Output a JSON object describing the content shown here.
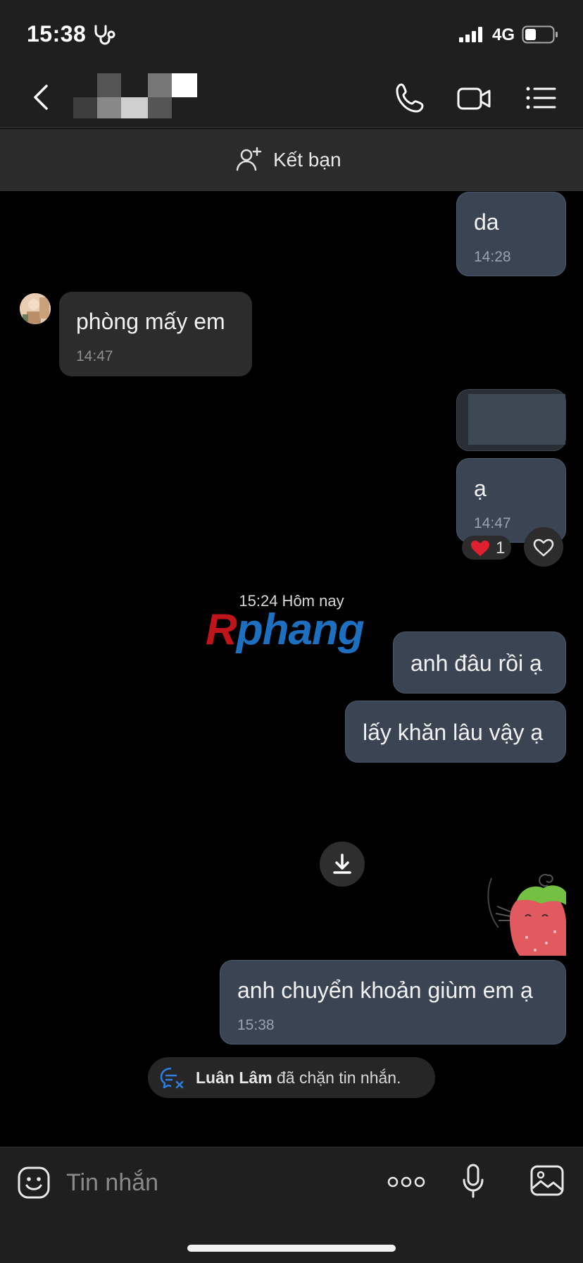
{
  "status_bar": {
    "time": "15:38",
    "network": "4G"
  },
  "header": {
    "contact_name": "",
    "icons": [
      "back-icon",
      "phone-icon",
      "video-icon",
      "menu-icon"
    ]
  },
  "add_friend": {
    "label": "Kết bạn"
  },
  "messages": [
    {
      "direction": "out",
      "text": "da",
      "time": "14:28"
    },
    {
      "direction": "in",
      "text": "phòng mấy em",
      "time": "14:47"
    },
    {
      "direction": "out",
      "text": "",
      "time": ""
    },
    {
      "direction": "out",
      "text": "ạ",
      "time": "14:47",
      "reaction": {
        "emoji": "heart",
        "count": "1"
      }
    },
    {
      "direction": "out",
      "text": "anh đâu rồi ạ",
      "time": ""
    },
    {
      "direction": "out",
      "text": "lấy khăn lâu vậy ạ",
      "time": ""
    },
    {
      "direction": "out",
      "text": "anh chuyển khoản giùm em ạ",
      "time": "15:38"
    }
  ],
  "date_separator": "15:24 Hôm nay",
  "watermark": {
    "first": "R",
    "rest": "phang"
  },
  "block_notice": {
    "name": "Luân Lâm",
    "text": " đã chặn tin nhắn."
  },
  "composer": {
    "placeholder": "Tin nhắn"
  },
  "colors": {
    "background": "#000000",
    "bar": "#1f1f1f",
    "outgoing_bubble": "#3a4452",
    "incoming_bubble": "#2c2c2c",
    "reaction_heart": "#e0202e"
  }
}
